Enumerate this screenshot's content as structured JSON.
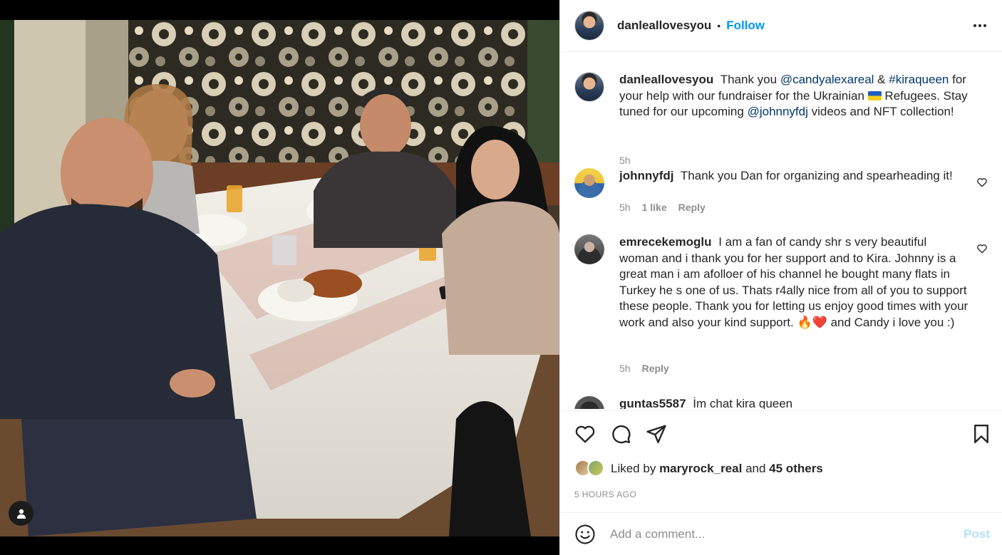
{
  "post": {
    "author": "danleallovesyou",
    "follow_label": "Follow",
    "separator": "•"
  },
  "caption": {
    "username": "danleallovesyou",
    "text_1": "Thank you",
    "mention_1": "@candyalexareal",
    "text_2": "&",
    "mention_2": "#kiraqueen",
    "text_3": "for your help with our fundraiser for the Ukrainian",
    "text_4": "Refugees. Stay tuned for our upcoming",
    "mention_3": "@johnnyfdj",
    "text_5": "videos and NFT collection!",
    "time": "5h"
  },
  "comments": [
    {
      "username": "johnnyfdj",
      "text": "Thank you Dan for organizing and spearheading it!",
      "time": "5h",
      "likes": "1 like",
      "reply_label": "Reply"
    },
    {
      "username": "emrecekemoglu",
      "text_1": "I am a fan of candy shr s very beautiful woman and i thank you for her support and to Kira. Johnny is a great man i am afolloer of his channel he bought many flats in Turkey he s one of us. Thats r4ally nice from all of you to support these people. Thank you for letting us enjoy good times with your work and also your kind support.",
      "emoji": "🔥❤️",
      "text_2": "and Candy i love you :)",
      "time": "5h",
      "reply_label": "Reply"
    },
    {
      "username": "guntas5587",
      "text": "İm chat kira queen"
    }
  ],
  "likes": {
    "prefix": "Liked by",
    "user": "maryrock_real",
    "conj": "and",
    "others": "45 others"
  },
  "timestamp": "5 hours ago",
  "composer": {
    "placeholder": "Add a comment...",
    "post_label": "Post"
  },
  "icons": {
    "like": "heart-icon",
    "comment": "comment-icon",
    "share": "paper-plane-icon",
    "save": "bookmark-icon",
    "more": "more-options-icon",
    "emoji": "emoji-icon",
    "tag": "user-tag-icon"
  },
  "colors": {
    "link": "#0095f6",
    "mention": "#00376b",
    "muted": "#8e8e8e",
    "post_disabled": "#b2dffc"
  }
}
